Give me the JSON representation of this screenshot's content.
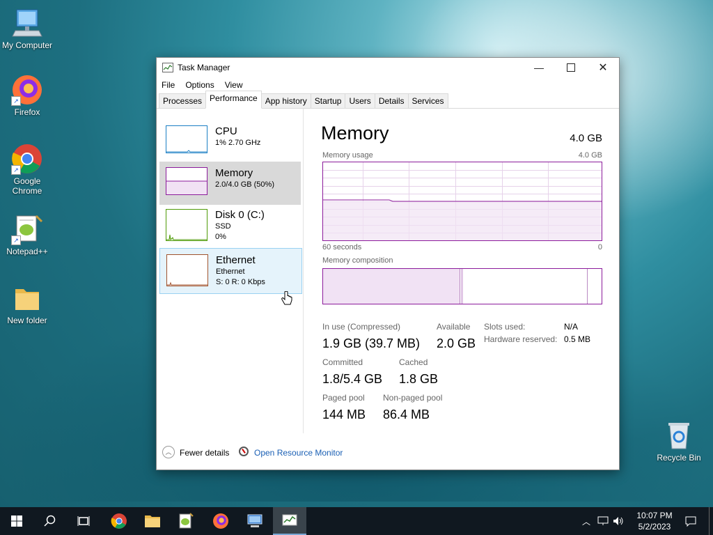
{
  "desktop": {
    "icons": [
      {
        "label": "My Computer"
      },
      {
        "label": "Firefox"
      },
      {
        "label": "Google Chrome"
      },
      {
        "label": "Notepad++"
      },
      {
        "label": "New folder"
      },
      {
        "label": "Recycle Bin"
      }
    ]
  },
  "window": {
    "title": "Task Manager",
    "menu": [
      "File",
      "Options",
      "View"
    ],
    "tabs": [
      "Processes",
      "Performance",
      "App history",
      "Startup",
      "Users",
      "Details",
      "Services"
    ],
    "active_tab": "Performance"
  },
  "perf_items": [
    {
      "title": "CPU",
      "line1": "1% 2.70 GHz",
      "line2": "",
      "color": "#1b7fc4"
    },
    {
      "title": "Memory",
      "line1": "2.0/4.0 GB (50%)",
      "line2": "",
      "color": "#8b1a9b"
    },
    {
      "title": "Disk 0 (C:)",
      "line1": "SSD",
      "line2": "0%",
      "color": "#4e9a06"
    },
    {
      "title": "Ethernet",
      "line1": "Ethernet",
      "line2": "S: 0 R: 0 Kbps",
      "color": "#a0522d"
    }
  ],
  "memory": {
    "title": "Memory",
    "capacity": "4.0 GB",
    "usage_label": "Memory usage",
    "usage_max": "4.0 GB",
    "time_left": "60 seconds",
    "time_right": "0",
    "composition_label": "Memory composition",
    "usage_level": 0.5,
    "stats": {
      "in_use_label": "In use (Compressed)",
      "in_use_value": "1.9 GB (39.7 MB)",
      "available_label": "Available",
      "available_value": "2.0 GB",
      "committed_label": "Committed",
      "committed_value": "1.8/5.4 GB",
      "cached_label": "Cached",
      "cached_value": "1.8 GB",
      "paged_label": "Paged pool",
      "paged_value": "144 MB",
      "nonpaged_label": "Non-paged pool",
      "nonpaged_value": "86.4 MB",
      "slots_label": "Slots used:",
      "slots_value": "N/A",
      "hw_label": "Hardware reserved:",
      "hw_value": "0.5 MB"
    }
  },
  "footer": {
    "fewer_details": "Fewer details",
    "resource_monitor": "Open Resource Monitor"
  },
  "taskbar": {
    "time": "10:07 PM",
    "date": "5/2/2023"
  },
  "colors": {
    "memory_accent": "#8b1a9b",
    "link": "#1a5fb4",
    "taskbar": "#101820"
  }
}
